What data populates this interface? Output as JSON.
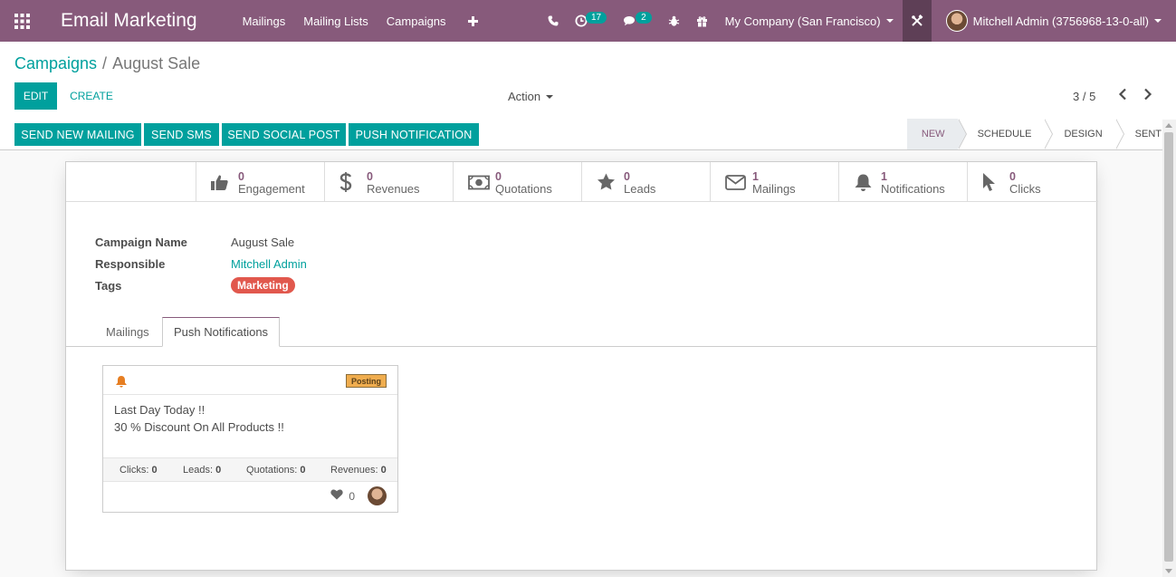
{
  "navbar": {
    "app_title": "Email Marketing",
    "menu": [
      "Mailings",
      "Mailing Lists",
      "Campaigns"
    ],
    "activity_count": "17",
    "messages_count": "2",
    "company": "My Company (San Francisco)",
    "user": "Mitchell Admin (3756968-13-0-all)"
  },
  "breadcrumb": {
    "parent": "Campaigns",
    "separator": "/",
    "current": "August Sale"
  },
  "buttons": {
    "edit": "EDIT",
    "create": "CREATE",
    "action": "Action"
  },
  "pager": {
    "text": "3 / 5"
  },
  "statusbar": {
    "buttons": [
      "SEND NEW MAILING",
      "SEND SMS",
      "SEND SOCIAL POST",
      "PUSH NOTIFICATION"
    ],
    "stages": [
      "NEW",
      "SCHEDULE",
      "DESIGN",
      "SENT"
    ],
    "active_stage": "NEW"
  },
  "stat_buttons": [
    {
      "value": "0",
      "label": "Engagement",
      "icon": "thumbs-up-icon"
    },
    {
      "value": "0",
      "label": "Revenues",
      "icon": "dollar-icon"
    },
    {
      "value": "0",
      "label": "Quotations",
      "icon": "money-icon"
    },
    {
      "value": "0",
      "label": "Leads",
      "icon": "star-icon"
    },
    {
      "value": "1",
      "label": "Mailings",
      "icon": "envelope-icon"
    },
    {
      "value": "1",
      "label": "Notifications",
      "icon": "bell-icon"
    },
    {
      "value": "0",
      "label": "Clicks",
      "icon": "pointer-icon"
    }
  ],
  "form": {
    "campaign_name_label": "Campaign Name",
    "campaign_name": "August Sale",
    "responsible_label": "Responsible",
    "responsible": "Mitchell Admin",
    "tags_label": "Tags",
    "tag": "Marketing"
  },
  "tabs": [
    "Mailings",
    "Push Notifications"
  ],
  "active_tab": "Push Notifications",
  "card": {
    "status": "Posting",
    "line1": "Last Day Today !!",
    "line2": "30 % Discount On All Products !!",
    "stats": {
      "clicks_label": "Clicks:",
      "clicks": "0",
      "leads_label": "Leads:",
      "leads": "0",
      "quotations_label": "Quotations:",
      "quotations": "0",
      "revenues_label": "Revenues:",
      "revenues": "0"
    },
    "likes": "0"
  },
  "colors": {
    "brand": "#875a7b",
    "accent": "#00a09d",
    "tag": "#e1584d",
    "posting": "#f0ad4e"
  }
}
